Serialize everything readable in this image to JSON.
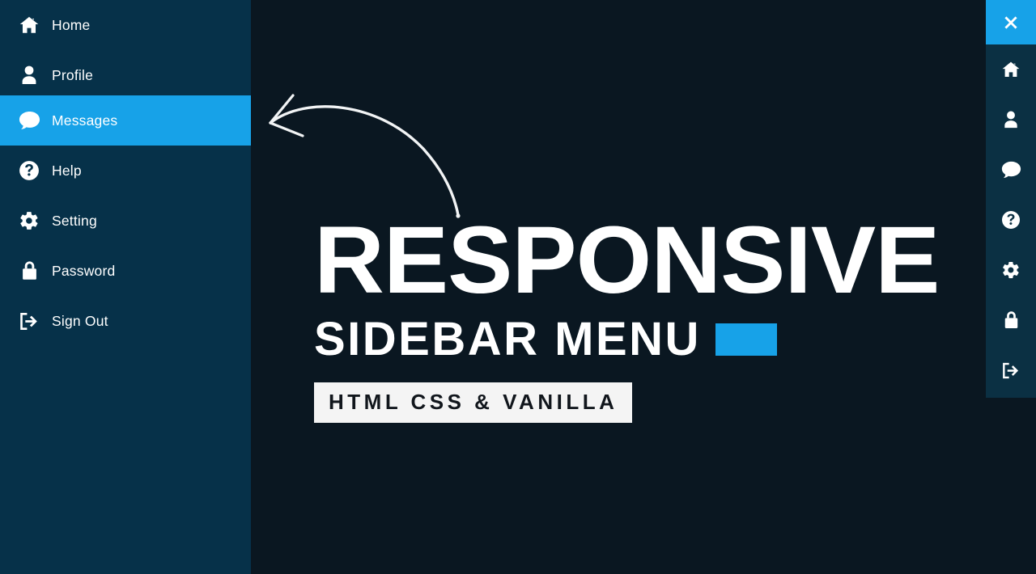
{
  "colors": {
    "sidebar_bg": "#063149",
    "mini_sidebar_bg": "#0b3043",
    "main_bg": "#0a1721",
    "accent": "#17a2e8",
    "text_light": "#ffffff",
    "tagline_box_bg": "#f4f4f4",
    "tagline_text": "#11161c"
  },
  "sidebar": {
    "items": [
      {
        "label": "Home",
        "icon": "home-icon",
        "active": false
      },
      {
        "label": "Profile",
        "icon": "user-icon",
        "active": false
      },
      {
        "label": "Messages",
        "icon": "message-icon",
        "active": true
      },
      {
        "label": "Help",
        "icon": "question-icon",
        "active": false
      },
      {
        "label": "Setting",
        "icon": "gear-icon",
        "active": false
      },
      {
        "label": "Password",
        "icon": "lock-icon",
        "active": false
      },
      {
        "label": "Sign Out",
        "icon": "sign-out-icon",
        "active": false
      }
    ]
  },
  "mini_sidebar": {
    "close_icon": "close-icon",
    "items": [
      {
        "icon": "home-icon"
      },
      {
        "icon": "user-icon"
      },
      {
        "icon": "message-icon"
      },
      {
        "icon": "question-icon"
      },
      {
        "icon": "gear-icon"
      },
      {
        "icon": "lock-icon"
      },
      {
        "icon": "sign-out-icon"
      }
    ]
  },
  "hero": {
    "title": "RESPONSIVE",
    "subtitle": "SIDEBAR MENU",
    "tagline": "HTML CSS & VANILLA"
  },
  "annotation": {
    "arrow": "curved-arrow-icon"
  }
}
